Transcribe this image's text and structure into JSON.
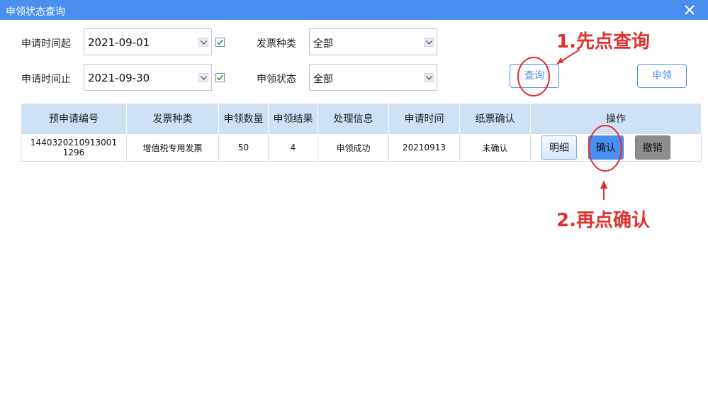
{
  "window": {
    "title": "申领状态查询",
    "close_icon": "close-icon"
  },
  "filters": {
    "start_label": "申请时间起",
    "start_value": "2021-09-01",
    "end_label": "申请时间止",
    "end_value": "2021-09-30",
    "invoice_type_label": "发票种类",
    "invoice_type_value": "全部",
    "status_label": "申领状态",
    "status_value": "全部"
  },
  "actions": {
    "query_label": "查询",
    "apply_label": "申领"
  },
  "table": {
    "headers": [
      "预申请编号",
      "发票种类",
      "申领数量",
      "申领结果",
      "处理信息",
      "申请时间",
      "纸票确认",
      "操作"
    ],
    "rows": [
      {
        "id": "1440320210913001 1296",
        "invoice_type": "增值税专用发票",
        "quantity": "50",
        "result": "4",
        "info": "申领成功",
        "date": "20210913",
        "paper_confirm": "未确认",
        "detail_label": "明细",
        "confirm_label": "确认",
        "cancel_label": "撤销"
      }
    ]
  },
  "annotations": {
    "step1": "1.先点查询",
    "step2": "2.再点确认",
    "color": "#e03030"
  },
  "colors": {
    "accent": "#4a8ef0",
    "header_bg": "#cfe2f5"
  }
}
